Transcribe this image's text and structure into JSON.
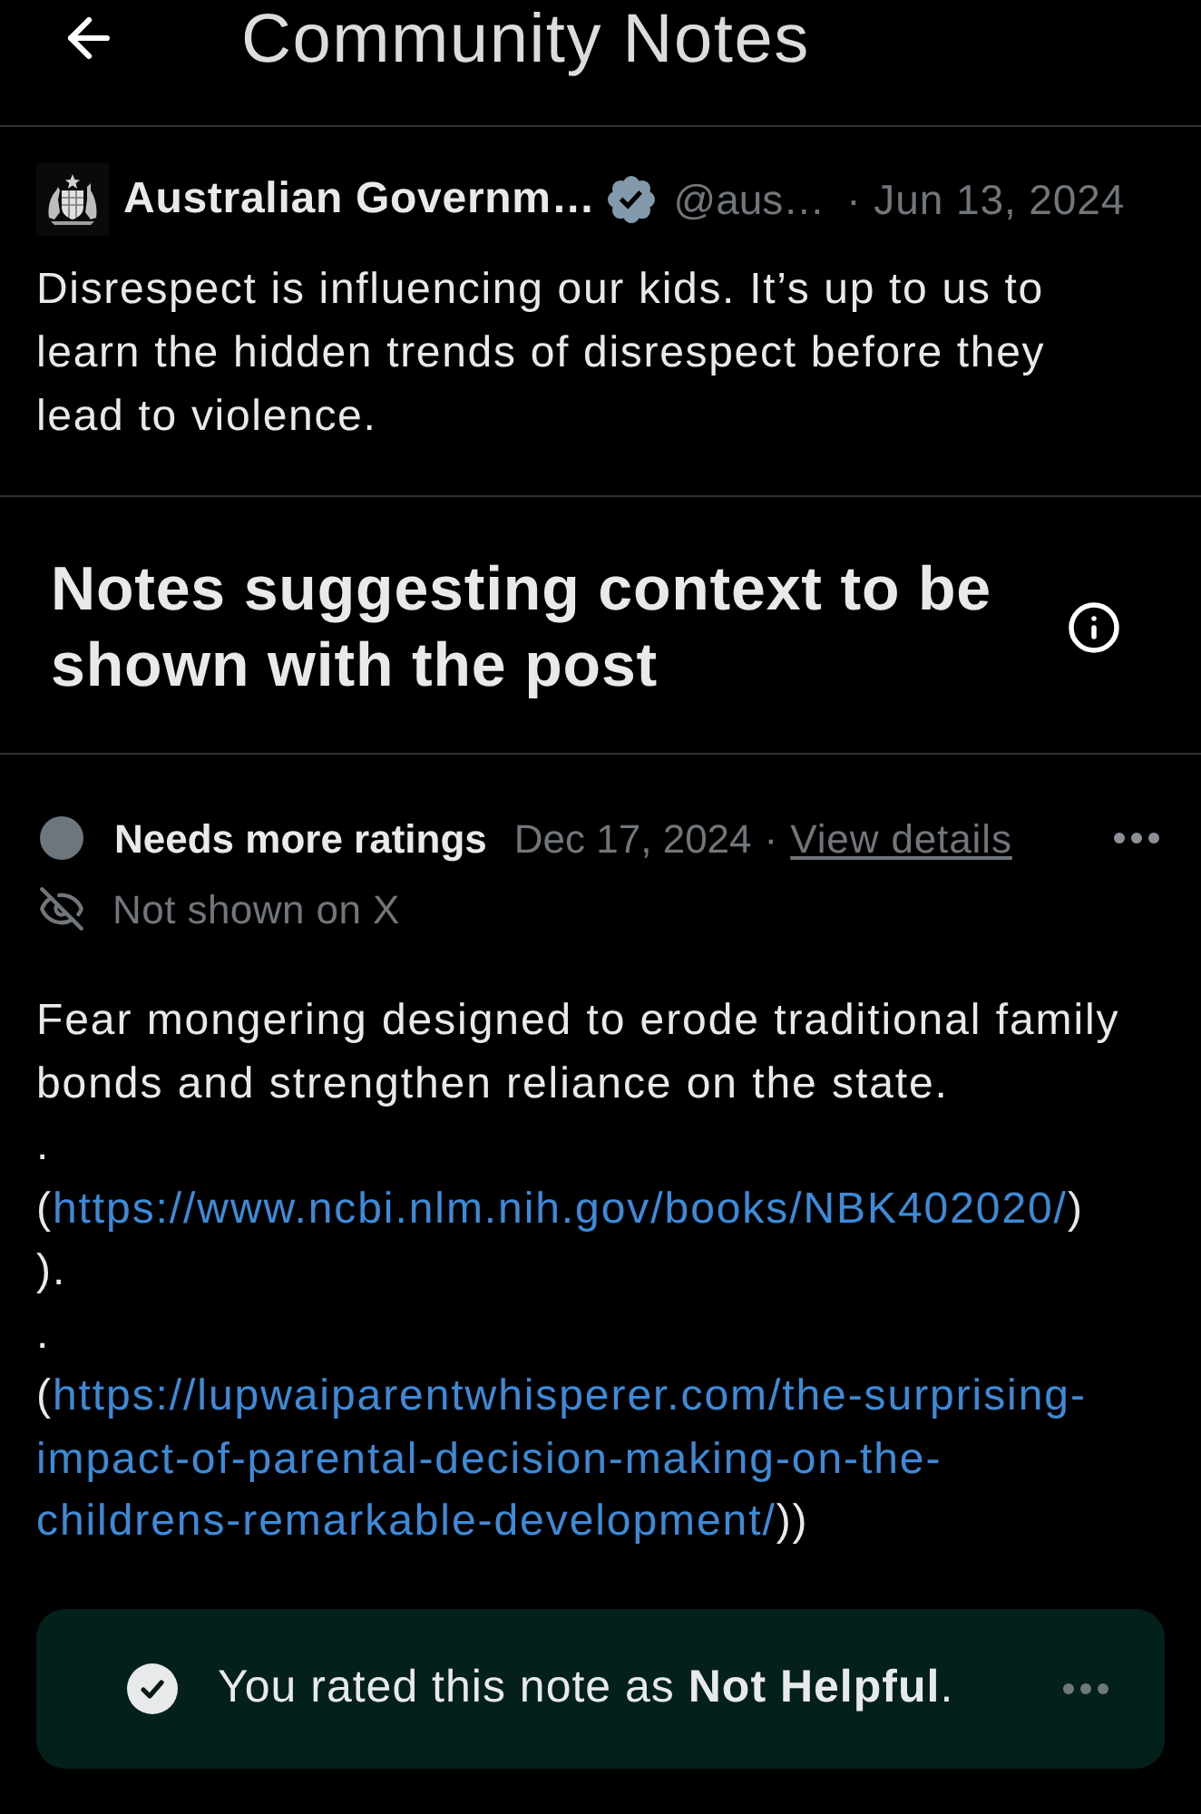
{
  "header": {
    "title": "Community Notes"
  },
  "post": {
    "author": "Australian Governm…",
    "verified": true,
    "handle": "@aus…",
    "date": "· Jun 13, 2024",
    "text": "Disrespect is influencing our kids. It’s up to us to learn the hidden trends of disrespect before they lead to violence."
  },
  "section": {
    "title": "Notes suggesting context to be shown with the post"
  },
  "note": {
    "status": {
      "label": "Needs more ratings",
      "color": "#6e767d"
    },
    "date": "Dec 17, 2024",
    "separator": "·",
    "details_link": "View details",
    "visibility": "Not shown on X",
    "body": [
      {
        "parts": [
          {
            "kind": "text",
            "text": "Fear mongering designed to erode traditional family bonds and strengthen reliance on the state."
          }
        ]
      },
      {
        "parts": [
          {
            "kind": "text",
            "text": "."
          }
        ]
      },
      {
        "parts": [
          {
            "kind": "text",
            "text": "("
          },
          {
            "kind": "link",
            "text": "https://www.ncbi.nlm.nih.gov/books/NBK402020/"
          },
          {
            "kind": "text",
            "text": ")"
          }
        ]
      },
      {
        "parts": [
          {
            "kind": "text",
            "text": ")."
          }
        ]
      },
      {
        "parts": [
          {
            "kind": "text",
            "text": "."
          }
        ]
      },
      {
        "parts": [
          {
            "kind": "text",
            "text": "("
          },
          {
            "kind": "link",
            "text": "https://lupwaiparentwhisperer.com/the-surprising-"
          }
        ]
      },
      {
        "parts": [
          {
            "kind": "link",
            "text": "impact-of-parental-decision-making-on-the-"
          }
        ]
      },
      {
        "parts": [
          {
            "kind": "link",
            "text": "childrens-remarkable-development/"
          },
          {
            "kind": "text",
            "text": "))"
          }
        ]
      }
    ]
  },
  "rating": {
    "text": "You rated this note as **Not Helpful**."
  }
}
